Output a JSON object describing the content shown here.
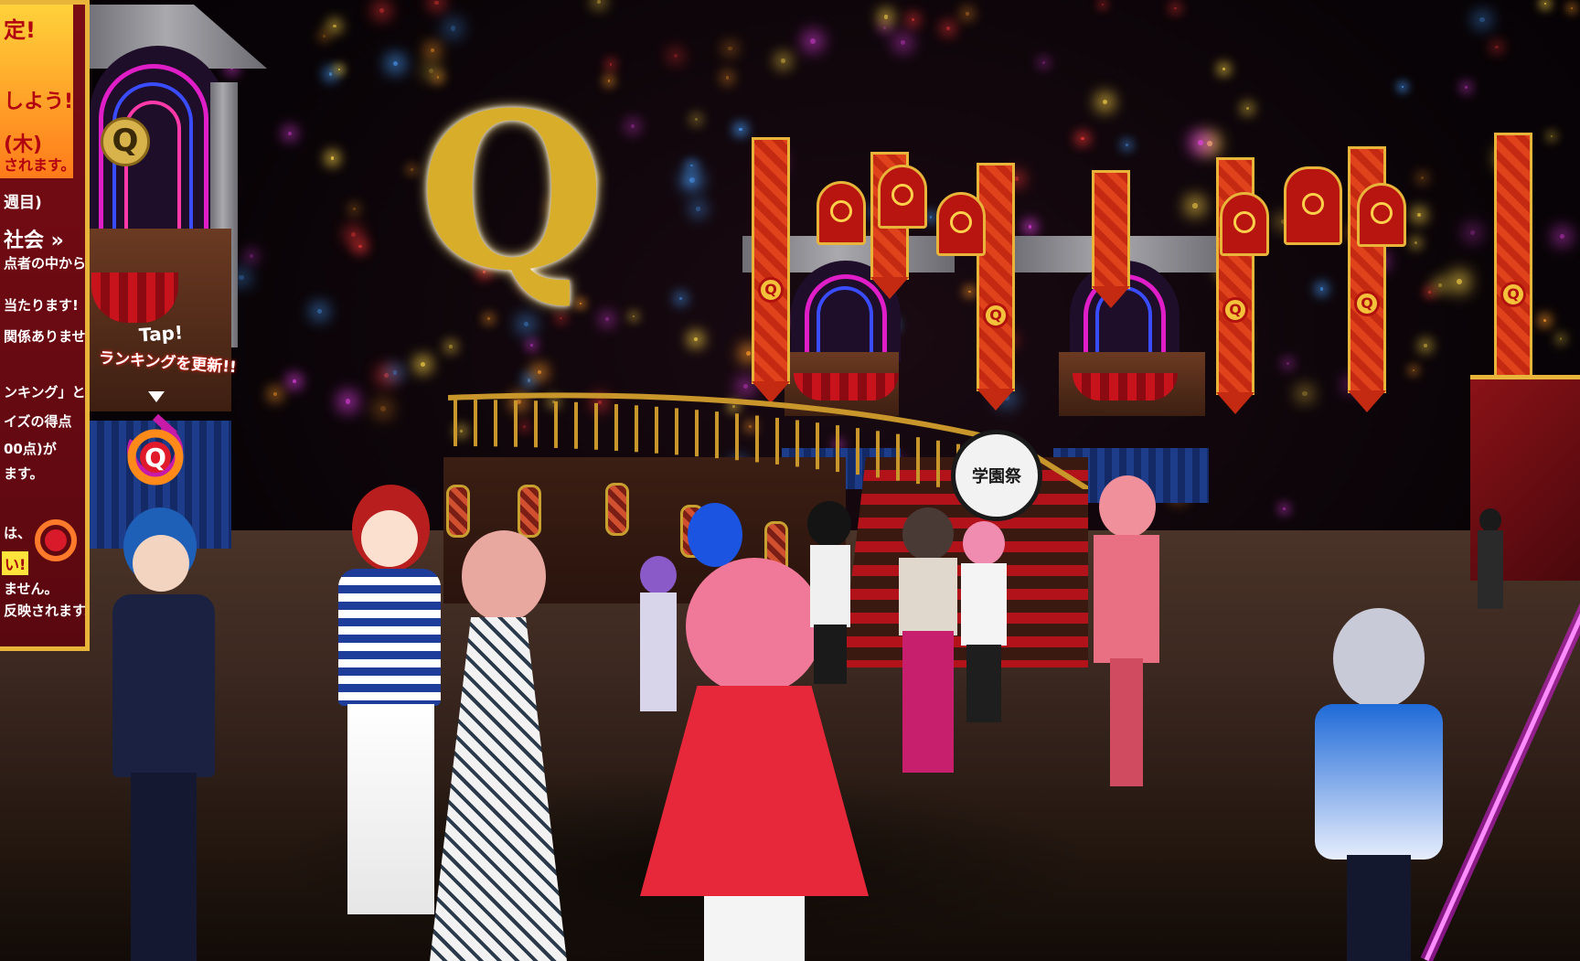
{
  "scene": {
    "logo_letter": "Q",
    "badge_letter": "Q"
  },
  "poster": {
    "lines": [
      "定!",
      "しよう!",
      "(木)",
      "されます。",
      "週目)",
      "社会 »",
      "点者の中から、",
      "当たります!",
      "関係ありません。",
      "ンキング」とは",
      "イズの得点",
      "00点)が",
      "ます。",
      "は、",
      "い!",
      "ません。",
      "反映されます。"
    ]
  },
  "hint": {
    "tap_label": "Tap!",
    "ranking_update_label": "ランキングを更新!!"
  },
  "sign": {
    "school_festival_text": "学園祭"
  },
  "colors": {
    "gold": "#d8ad2a",
    "banner_red": "#c42a12",
    "neon_magenta": "#e01ec8",
    "neon_blue": "#3a4cff",
    "floor": "#3a271f"
  },
  "icons": {
    "ranking_refresh": "ranking-refresh-icon",
    "poster_badge": "q-badge-icon"
  }
}
